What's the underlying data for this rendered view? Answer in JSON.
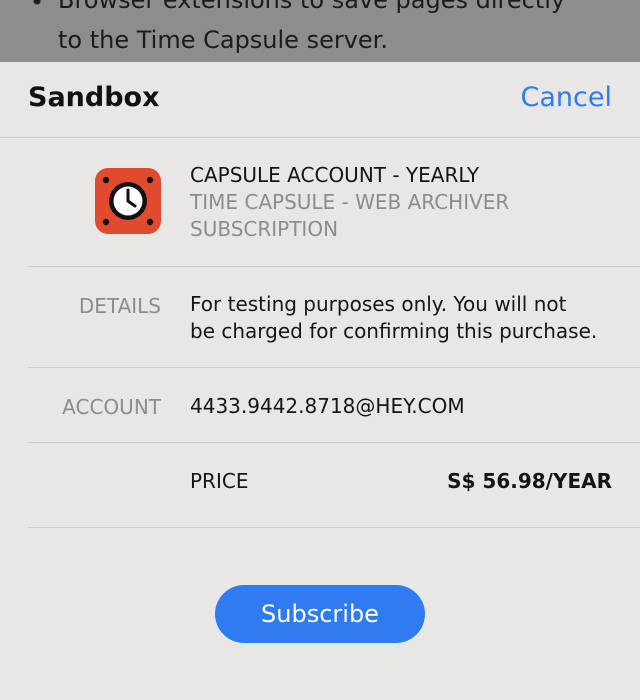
{
  "background": {
    "line1": "Browser extensions to save pages directly",
    "line2": "to the Time Capsule server."
  },
  "sheet": {
    "title": "Sandbox",
    "cancel_label": "Cancel",
    "product": {
      "name": "CAPSULE ACCOUNT - YEARLY",
      "app_name": "TIME CAPSULE - WEB ARCHIVER",
      "kind": "SUBSCRIPTION",
      "icon": "alarm-clock-icon"
    },
    "details": {
      "label": "DETAILS",
      "line1": "For testing purposes only. You will not",
      "line2": "be charged for confirming this purchase."
    },
    "account": {
      "label": "ACCOUNT",
      "value": "4433.9442.8718@HEY.COM"
    },
    "price": {
      "label": "PRICE",
      "value": "S$ 56.98/YEAR"
    },
    "subscribe_label": "Subscribe"
  },
  "colors": {
    "accent": "#2f7cf0",
    "icon_bg": "#e04b2f",
    "sheet_bg": "#e9e7e5"
  }
}
